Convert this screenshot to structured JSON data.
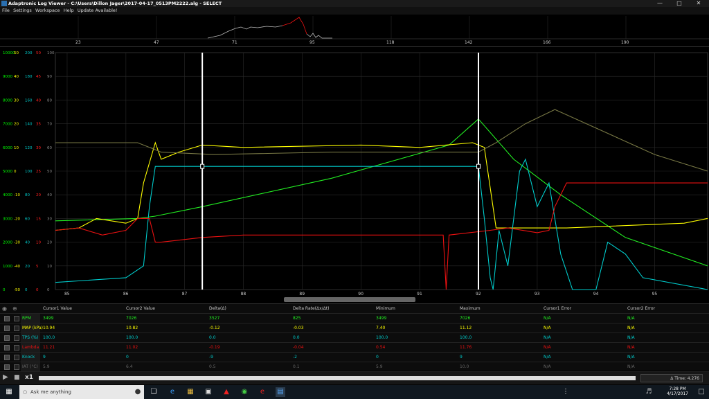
{
  "window": {
    "title": "Adaptronic Log Viewer - C:\\Users\\Dillon Jager\\2017-04-17_0513PM2222.alg - SELECT",
    "minimize": "—",
    "maximize": "□",
    "close": "✕"
  },
  "menu": [
    "File",
    "Settings",
    "Workspace",
    "Help",
    "Update Available!"
  ],
  "overview_ticks": [
    "23",
    "47",
    "71",
    "95",
    "118",
    "142",
    "166",
    "190"
  ],
  "chart_data": {
    "type": "line",
    "x_range": [
      84.8,
      95.9
    ],
    "x_ticks": [
      "85",
      "86",
      "87",
      "88",
      "89",
      "90",
      "91",
      "92",
      "93",
      "94",
      "95"
    ],
    "cursors": [
      87.3,
      92.0
    ],
    "axes": [
      {
        "color": "#00ff00",
        "ticks": [
          "10000",
          "9000",
          "8000",
          "7000",
          "6000",
          "5000",
          "4000",
          "3000",
          "2000",
          "1000",
          "0"
        ]
      },
      {
        "color": "#ffff00",
        "ticks": [
          "50",
          "40",
          "30",
          "20",
          "10",
          "0",
          "-10",
          "-20",
          "-30",
          "-40",
          "-50"
        ]
      },
      {
        "color": "#00cccc",
        "ticks": [
          "200",
          "180",
          "160",
          "140",
          "120",
          "100",
          "80",
          "60",
          "40",
          "20",
          "0"
        ]
      },
      {
        "color": "#ff2020",
        "ticks": [
          "50",
          "45",
          "40",
          "35",
          "30",
          "25",
          "20",
          "15",
          "10",
          "5",
          "0"
        ]
      },
      {
        "color": "#888888",
        "ticks": [
          "100",
          "90",
          "80",
          "70",
          "60",
          "50",
          "40",
          "30",
          "20",
          "10",
          "0"
        ]
      }
    ],
    "series": [
      {
        "color": "#22ee22",
        "x": [
          84.8,
          86.2,
          86.5,
          87.3,
          89.5,
          91.5,
          92.0,
          92.6,
          93.4,
          94.5,
          95.9
        ],
        "y": [
          0.29,
          0.3,
          0.31,
          0.35,
          0.47,
          0.61,
          0.72,
          0.55,
          0.4,
          0.22,
          0.1
        ]
      },
      {
        "color": "#ffff00",
        "x": [
          84.8,
          85.2,
          85.5,
          86.0,
          86.2,
          86.3,
          86.5,
          86.6,
          86.9,
          87.3,
          88.0,
          90.0,
          91.0,
          91.9,
          92.1,
          92.3,
          93.5,
          95.5,
          95.9
        ],
        "y": [
          0.25,
          0.26,
          0.3,
          0.28,
          0.3,
          0.45,
          0.62,
          0.55,
          0.58,
          0.61,
          0.6,
          0.61,
          0.6,
          0.62,
          0.6,
          0.26,
          0.26,
          0.28,
          0.3
        ]
      },
      {
        "color": "#00cccc",
        "x": [
          84.8,
          86.0,
          86.3,
          86.4,
          86.5,
          87.3,
          91.5,
          91.95,
          92.0,
          92.1,
          92.2,
          92.25,
          92.35,
          92.5,
          92.7,
          92.8,
          93.0,
          93.2,
          93.4,
          93.6,
          93.8,
          94.0,
          94.2,
          94.5,
          94.8,
          95.9
        ],
        "y": [
          0.03,
          0.05,
          0.1,
          0.35,
          0.52,
          0.52,
          0.52,
          0.52,
          0.52,
          0.3,
          0.05,
          0.0,
          0.25,
          0.1,
          0.5,
          0.55,
          0.35,
          0.45,
          0.15,
          0.0,
          0.0,
          0.0,
          0.2,
          0.15,
          0.05,
          0.0
        ]
      },
      {
        "color": "#ee1111",
        "x": [
          84.8,
          85.2,
          85.6,
          86.0,
          86.2,
          86.4,
          86.5,
          86.6,
          87.3,
          88.0,
          90.0,
          91.4,
          91.45,
          91.5,
          92.2,
          92.5,
          93.0,
          93.2,
          93.3,
          93.5,
          94.5,
          95.9
        ],
        "y": [
          0.25,
          0.26,
          0.23,
          0.25,
          0.3,
          0.3,
          0.2,
          0.2,
          0.22,
          0.23,
          0.23,
          0.23,
          0.0,
          0.23,
          0.25,
          0.26,
          0.24,
          0.25,
          0.35,
          0.45,
          0.45,
          0.45
        ]
      },
      {
        "color": "#777744",
        "x": [
          84.8,
          86.2,
          86.4,
          86.6,
          87.5,
          89.5,
          91.0,
          92.0,
          92.3,
          92.8,
          93.3,
          95.0,
          95.9
        ],
        "y": [
          0.62,
          0.62,
          0.6,
          0.58,
          0.57,
          0.58,
          0.58,
          0.58,
          0.62,
          0.7,
          0.76,
          0.57,
          0.5
        ]
      }
    ]
  },
  "table": {
    "headers": [
      "Cursor1 Value",
      "Cursor2 Value",
      "Delta(Δ)",
      "Delta Rate(Δx/Δt)",
      "Minimum",
      "Maximum",
      "Cursor1 Error",
      "Cursor2 Error"
    ],
    "rows": [
      {
        "name": "RPM",
        "color": "#22ee22",
        "values": [
          "3499",
          "7026",
          "3527",
          "825",
          "3499",
          "7026",
          "N/A",
          "N/A"
        ]
      },
      {
        "name": "MAP (kPa)",
        "color": "#ffff00",
        "values": [
          "10.94",
          "10.82",
          "-0.12",
          "-0.03",
          "7.40",
          "11.12",
          "N/A",
          "N/A"
        ]
      },
      {
        "name": "TPS (%)",
        "color": "#00cccc",
        "values": [
          "100.0",
          "100.0",
          "0.0",
          "0.0",
          "100.0",
          "100.0",
          "N/A",
          "N/A"
        ]
      },
      {
        "name": "Lambda",
        "color": "#ee1111",
        "values": [
          "11.21",
          "11.02",
          "-0.19",
          "-0.04",
          "0.54",
          "11.76",
          "N/A",
          "N/A"
        ]
      },
      {
        "name": "Knock",
        "color": "#00cccc",
        "values": [
          "9",
          "0",
          "-9",
          "-2",
          "0",
          "9",
          "N/A",
          "N/A"
        ]
      },
      {
        "name": "IAT (°C)",
        "color": "#666666",
        "values": [
          "5.9",
          "6.4",
          "0.5",
          "0.1",
          "5.9",
          "10.0",
          "N/A",
          "N/A"
        ]
      }
    ]
  },
  "playback": {
    "play": "▶",
    "stop": "■",
    "speed": "x1",
    "time": "Δ Time: 4.276"
  },
  "taskbar": {
    "search_placeholder": "Ask me anything",
    "time": "7:28 PM",
    "date": "4/17/2017"
  }
}
